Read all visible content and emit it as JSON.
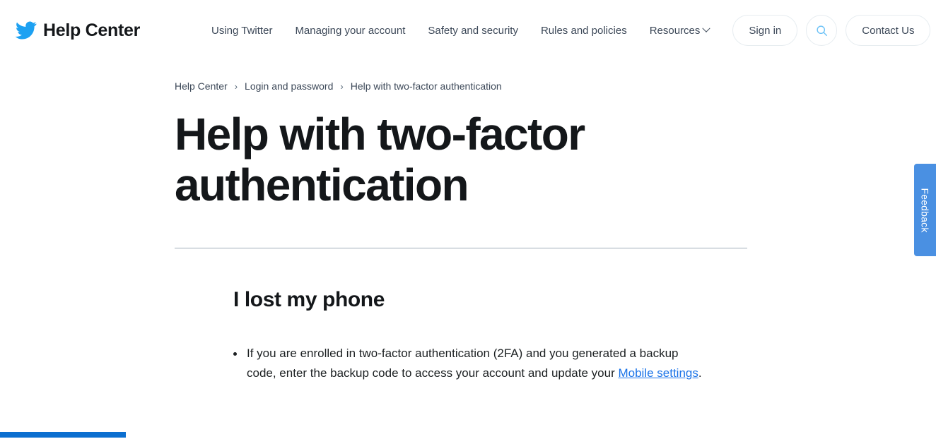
{
  "header": {
    "brand": {
      "icon": "twitter-bird-icon",
      "name": "Help Center"
    },
    "nav": [
      {
        "label": "Using Twitter",
        "has_dropdown": false
      },
      {
        "label": "Managing your account",
        "has_dropdown": false
      },
      {
        "label": "Safety and security",
        "has_dropdown": false
      },
      {
        "label": "Rules and policies",
        "has_dropdown": false
      },
      {
        "label": "Resources",
        "has_dropdown": true
      }
    ],
    "sign_in_label": "Sign in",
    "search_icon": "search-icon",
    "contact_label": "Contact Us",
    "accent_color": "#1da1f2",
    "border_color": "#e6ecf0"
  },
  "breadcrumb": {
    "items": [
      "Help Center",
      "Login and password",
      "Help with two-factor authentication"
    ],
    "separator": "›"
  },
  "page": {
    "title": "Help with two-factor authentication"
  },
  "article": {
    "section_heading": "I lost my phone",
    "bullets": [
      {
        "text_before": "If you are enrolled in two-factor authentication (2FA) and you generated a backup code, enter the backup code to access your account and update your ",
        "link_text": "Mobile settings",
        "text_after": "."
      }
    ],
    "link_color": "#1a73e8"
  },
  "feedback": {
    "label": "Feedback",
    "color": "#4a90e2"
  },
  "progress": {
    "color": "#0c6fd0"
  }
}
